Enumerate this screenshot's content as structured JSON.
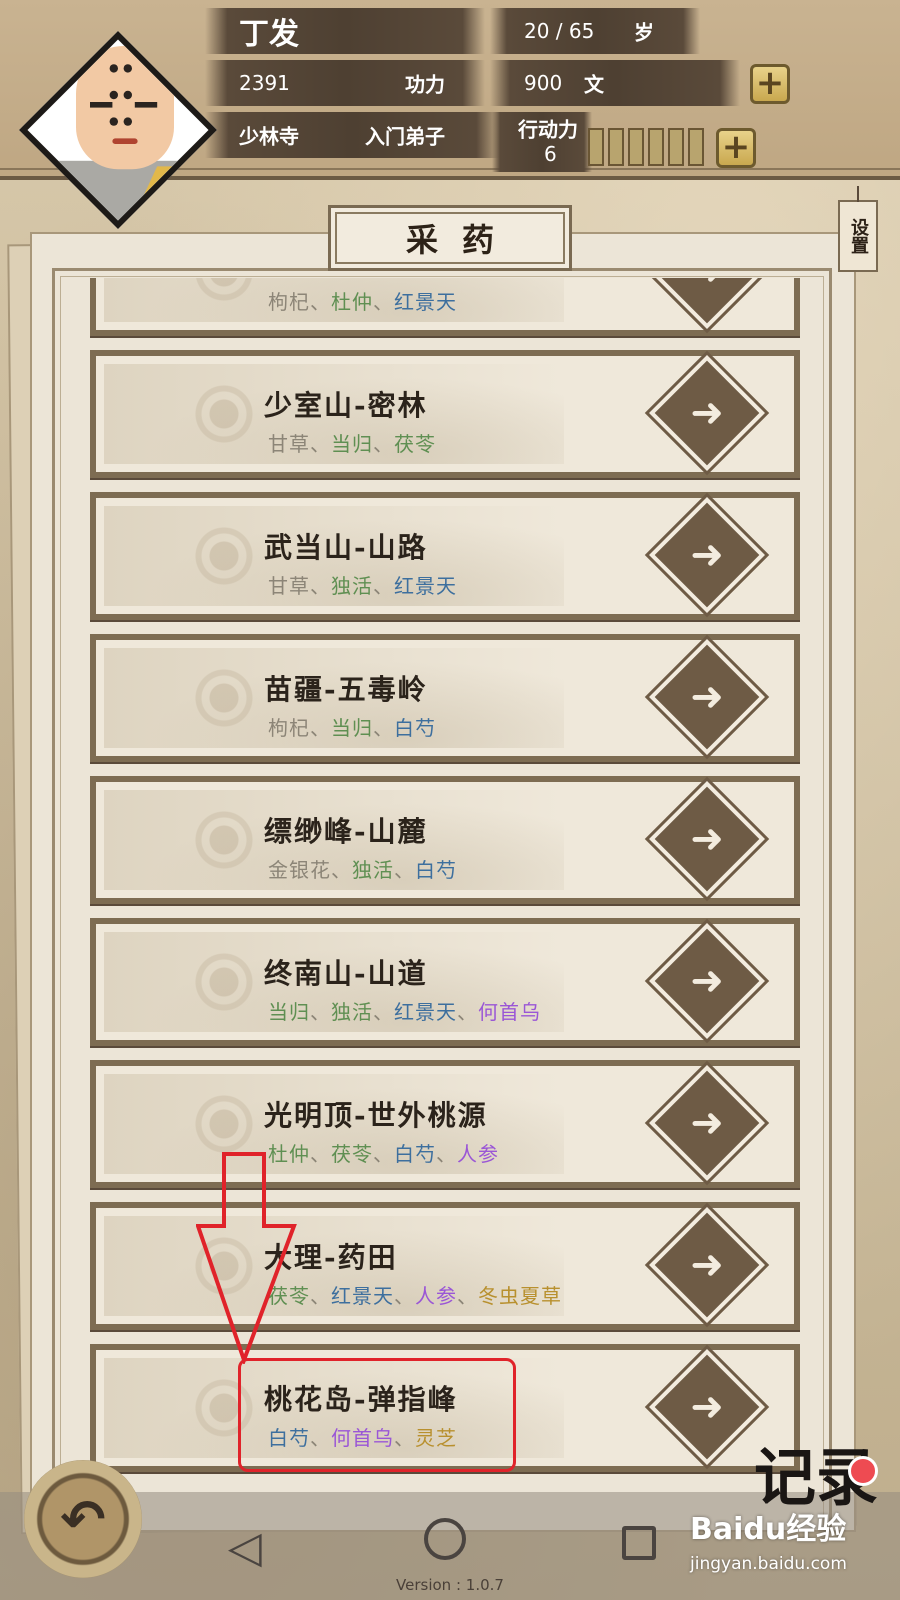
{
  "player": {
    "name": "丁发",
    "age": "20 / 65",
    "age_unit": "岁",
    "power_value": "2391",
    "power_label": "功力",
    "money_value": "900",
    "money_unit": "文",
    "sect": "少林寺",
    "rank": "入门弟子",
    "stamina_label": "行动力",
    "stamina_value": "6"
  },
  "page": {
    "title": "采药",
    "settings_label": "设置"
  },
  "herb_colors": {
    "common": "#8c8577",
    "green": "#5f8f52",
    "blue": "#3d6f9e",
    "purple": "#9a56d6",
    "gold": "#b8902e"
  },
  "locations": [
    {
      "name": "",
      "herbs": [
        {
          "text": "枸杞",
          "tier": "common"
        },
        {
          "text": "杜仲",
          "tier": "green"
        },
        {
          "text": "红景天",
          "tier": "blue"
        }
      ]
    },
    {
      "name": "少室山-密林",
      "herbs": [
        {
          "text": "甘草",
          "tier": "common"
        },
        {
          "text": "当归",
          "tier": "green"
        },
        {
          "text": "茯苓",
          "tier": "green"
        }
      ]
    },
    {
      "name": "武当山-山路",
      "herbs": [
        {
          "text": "甘草",
          "tier": "common"
        },
        {
          "text": "独活",
          "tier": "green"
        },
        {
          "text": "红景天",
          "tier": "blue"
        }
      ]
    },
    {
      "name": "苗疆-五毒岭",
      "herbs": [
        {
          "text": "枸杞",
          "tier": "common"
        },
        {
          "text": "当归",
          "tier": "green"
        },
        {
          "text": "白芍",
          "tier": "blue"
        }
      ]
    },
    {
      "name": "缥缈峰-山麓",
      "herbs": [
        {
          "text": "金银花",
          "tier": "common"
        },
        {
          "text": "独活",
          "tier": "green"
        },
        {
          "text": "白芍",
          "tier": "blue"
        }
      ]
    },
    {
      "name": "终南山-山道",
      "herbs": [
        {
          "text": "当归",
          "tier": "green"
        },
        {
          "text": "独活",
          "tier": "green"
        },
        {
          "text": "红景天",
          "tier": "blue"
        },
        {
          "text": "何首乌",
          "tier": "purple"
        }
      ]
    },
    {
      "name": "光明顶-世外桃源",
      "herbs": [
        {
          "text": "杜仲",
          "tier": "green"
        },
        {
          "text": "茯苓",
          "tier": "green"
        },
        {
          "text": "白芍",
          "tier": "blue"
        },
        {
          "text": "人参",
          "tier": "purple"
        }
      ]
    },
    {
      "name": "大理-药田",
      "herbs": [
        {
          "text": "茯苓",
          "tier": "green"
        },
        {
          "text": "红景天",
          "tier": "blue"
        },
        {
          "text": "人参",
          "tier": "purple"
        },
        {
          "text": "冬虫夏草",
          "tier": "gold"
        }
      ]
    },
    {
      "name": "桃花岛-弹指峰",
      "herbs": [
        {
          "text": "白芍",
          "tier": "blue"
        },
        {
          "text": "何首乌",
          "tier": "purple"
        },
        {
          "text": "灵芝",
          "tier": "gold"
        }
      ]
    }
  ],
  "separator": "、",
  "footer": {
    "version": "Version : 1.0.7",
    "logo_text": "记录",
    "watermark_title": "Baidu经验",
    "watermark_url": "jingyan.baidu.com"
  }
}
